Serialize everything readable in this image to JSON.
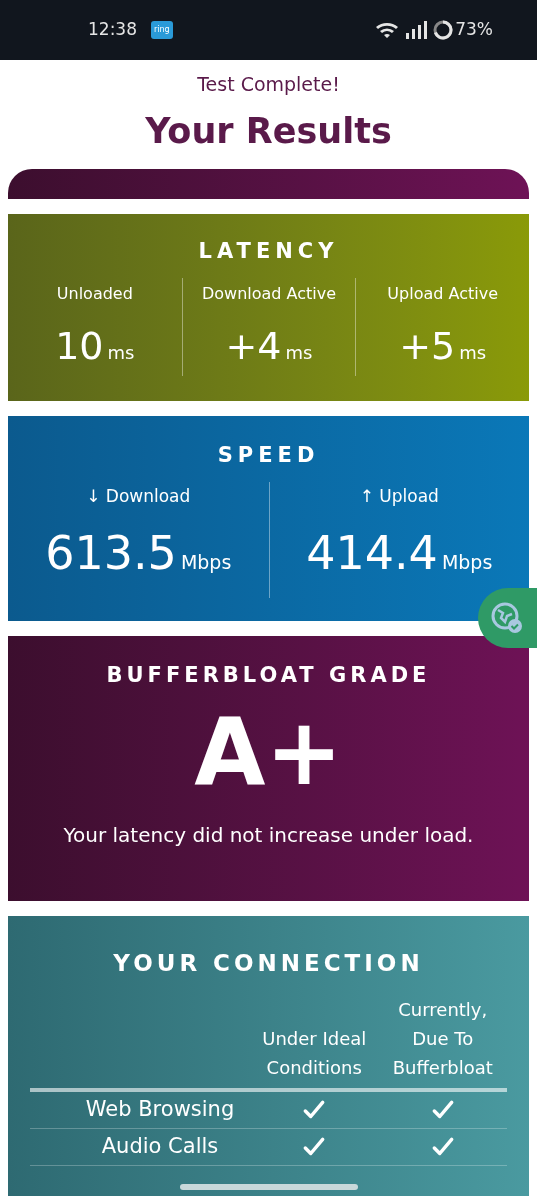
{
  "status_bar": {
    "time": "12:38",
    "app_badge": "ring",
    "battery": "73%"
  },
  "header": {
    "subtitle": "Test Complete!",
    "title": "Your Results"
  },
  "latency": {
    "title": "LATENCY",
    "items": [
      {
        "label": "Unloaded",
        "value": "10",
        "unit": "ms"
      },
      {
        "label": "Download Active",
        "value": "+4",
        "unit": "ms"
      },
      {
        "label": "Upload Active",
        "value": "+5",
        "unit": "ms"
      }
    ]
  },
  "speed": {
    "title": "SPEED",
    "items": [
      {
        "arrow": "↓",
        "label": "Download",
        "value": "613.5",
        "unit": "Mbps"
      },
      {
        "arrow": "↑",
        "label": "Upload",
        "value": "414.4",
        "unit": "Mbps"
      }
    ]
  },
  "bufferbloat": {
    "title": "BUFFERBLOAT GRADE",
    "grade": "A+",
    "message": "Your latency did not increase under load."
  },
  "connection": {
    "title": "YOUR CONNECTION",
    "columns": [
      "Under Ideal Conditions",
      "Currently, Due To Bufferbloat"
    ],
    "rows": [
      {
        "label": "Web Browsing",
        "ideal": true,
        "current": true
      },
      {
        "label": "Audio Calls",
        "ideal": true,
        "current": true
      }
    ]
  }
}
